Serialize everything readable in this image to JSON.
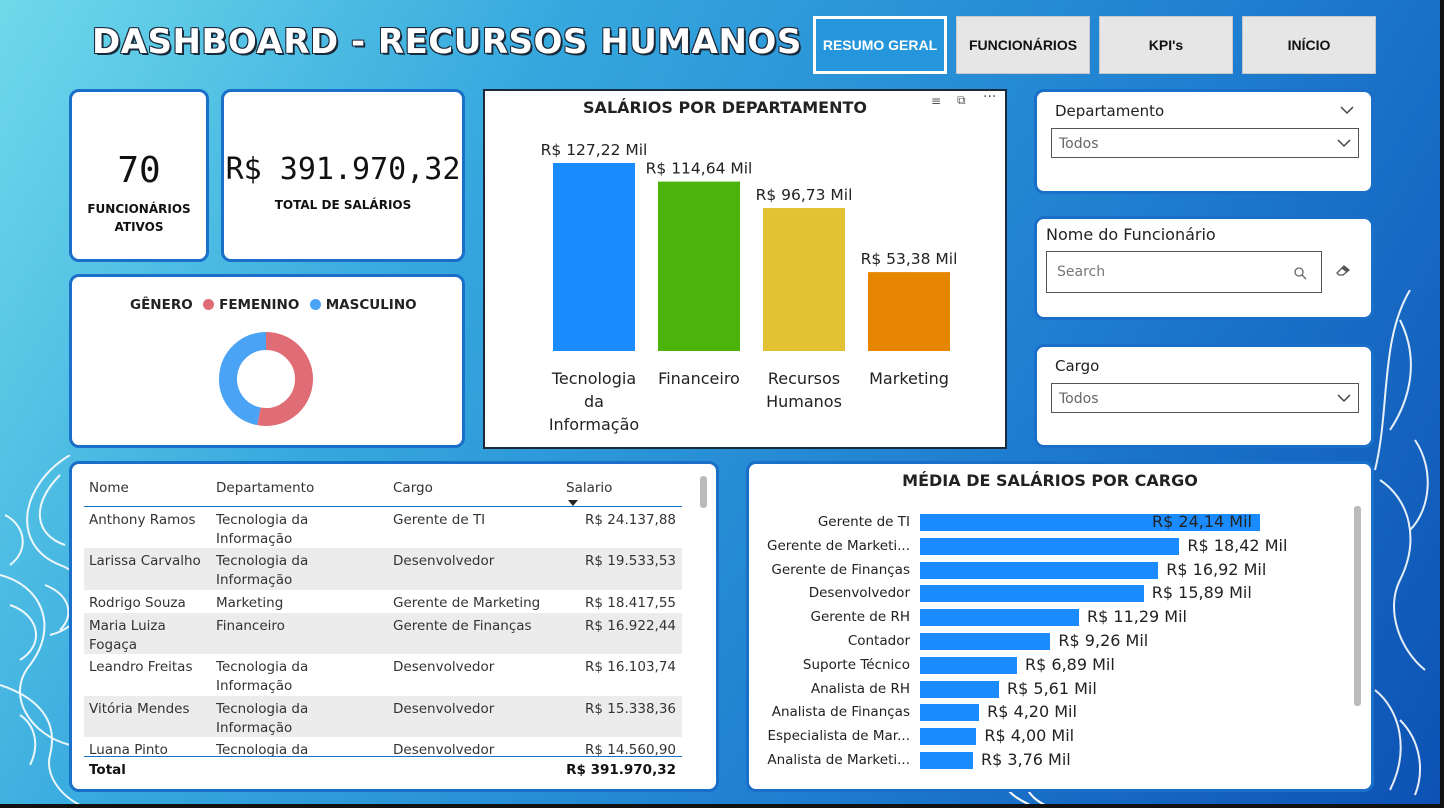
{
  "header": {
    "title": "DASHBOARD - RECURSOS HUMANOS"
  },
  "nav": [
    {
      "label": "RESUMO GERAL",
      "active": true
    },
    {
      "label": "FUNCIONÁRIOS",
      "active": false
    },
    {
      "label": "KPI's",
      "active": false
    },
    {
      "label": "INÍCIO",
      "active": false
    }
  ],
  "kpis": {
    "funcionarios": {
      "value": "70",
      "label": "FUNCIONÁRIOS ATIVOS"
    },
    "salarios": {
      "value": "R$ 391.970,32",
      "label": "TOTAL DE SALÁRIOS"
    }
  },
  "gender": {
    "title": "GÊNERO",
    "legend": [
      {
        "name": "FEMENINO",
        "color": "#e06c75",
        "share": 0.53
      },
      {
        "name": "MASCULINO",
        "color": "#4aa3f5",
        "share": 0.47
      }
    ]
  },
  "dept_chart": {
    "title": "SALÁRIOS POR DEPARTAMENTO",
    "colors": [
      "#1a8cff",
      "#4cb30a",
      "#e2c132",
      "#e58500"
    ],
    "chart_data": {
      "type": "bar",
      "categories": [
        "Tecnologia da Informação",
        "Financeiro",
        "Recursos Humanos",
        "Marketing"
      ],
      "values": [
        127.22,
        114.64,
        96.73,
        53.38
      ],
      "labels": [
        "R$ 127,22 Mil",
        "R$ 114,64 Mil",
        "R$ 96,73 Mil",
        "R$ 53,38 Mil"
      ],
      "category_lines": [
        [
          "Tecnologia",
          "da",
          "Informação"
        ],
        [
          "Financeiro"
        ],
        [
          "Recursos",
          "Humanos"
        ],
        [
          "Marketing"
        ]
      ],
      "ylabel": "",
      "unit": "Mil"
    }
  },
  "filters": {
    "departamento": {
      "label": "Departamento",
      "value": "Todos"
    },
    "nome": {
      "label": "Nome do Funcionário",
      "placeholder": "Search"
    },
    "cargo": {
      "label": "Cargo",
      "value": "Todos"
    }
  },
  "table": {
    "headers": [
      "Nome",
      "Departamento",
      "Cargo",
      "Salario"
    ],
    "rows": [
      {
        "nome": "Anthony Ramos",
        "dept": [
          "Tecnologia da",
          "Informação"
        ],
        "cargo": "Gerente de TI",
        "salario": "R$ 24.137,88"
      },
      {
        "nome": "Larissa Carvalho",
        "dept": [
          "Tecnologia da",
          "Informação"
        ],
        "cargo": "Desenvolvedor",
        "salario": "R$ 19.533,53"
      },
      {
        "nome": "Rodrigo Souza",
        "dept": [
          "Marketing"
        ],
        "cargo": "Gerente de Marketing",
        "salario": "R$ 18.417,55"
      },
      {
        "nome": [
          "Maria Luiza",
          "Fogaça"
        ],
        "dept": [
          "Financeiro"
        ],
        "cargo": "Gerente de Finanças",
        "salario": "R$ 16.922,44"
      },
      {
        "nome": "Leandro Freitas",
        "dept": [
          "Tecnologia da",
          "Informação"
        ],
        "cargo": "Desenvolvedor",
        "salario": "R$ 16.103,74"
      },
      {
        "nome": "Vitória Mendes",
        "dept": [
          "Tecnologia da",
          "Informação"
        ],
        "cargo": "Desenvolvedor",
        "salario": "R$ 15.338,36"
      },
      {
        "nome": "Luana Pinto",
        "dept": [
          "Tecnologia da"
        ],
        "cargo": "Desenvolvedor",
        "salario": "R$ 14.560,90"
      }
    ],
    "total_label": "Total",
    "total_value": "R$ 391.970,32"
  },
  "cargo_chart": {
    "title": "MÉDIA DE SALÁRIOS POR CARGO",
    "color": "#1a8cff",
    "chart_data": {
      "type": "bar",
      "orientation": "horizontal",
      "categories": [
        "Gerente de TI",
        "Gerente de Marketi...",
        "Gerente de Finanças",
        "Desenvolvedor",
        "Gerente de RH",
        "Contador",
        "Suporte Técnico",
        "Analista de RH",
        "Analista de Finanças",
        "Especialista de Mar...",
        "Analista de Marketi..."
      ],
      "values": [
        24.14,
        18.42,
        16.92,
        15.89,
        11.29,
        9.26,
        6.89,
        5.61,
        4.2,
        4.0,
        3.76
      ],
      "labels": [
        "R$ 24,14 Mil",
        "R$ 18,42 Mil",
        "R$ 16,92 Mil",
        "R$ 15,89 Mil",
        "R$ 11,29 Mil",
        "R$ 9,26 Mil",
        "R$ 6,89 Mil",
        "R$ 5,61 Mil",
        "R$ 4,20 Mil",
        "R$ 4,00 Mil",
        "R$ 3,76 Mil"
      ],
      "unit": "Mil"
    }
  }
}
